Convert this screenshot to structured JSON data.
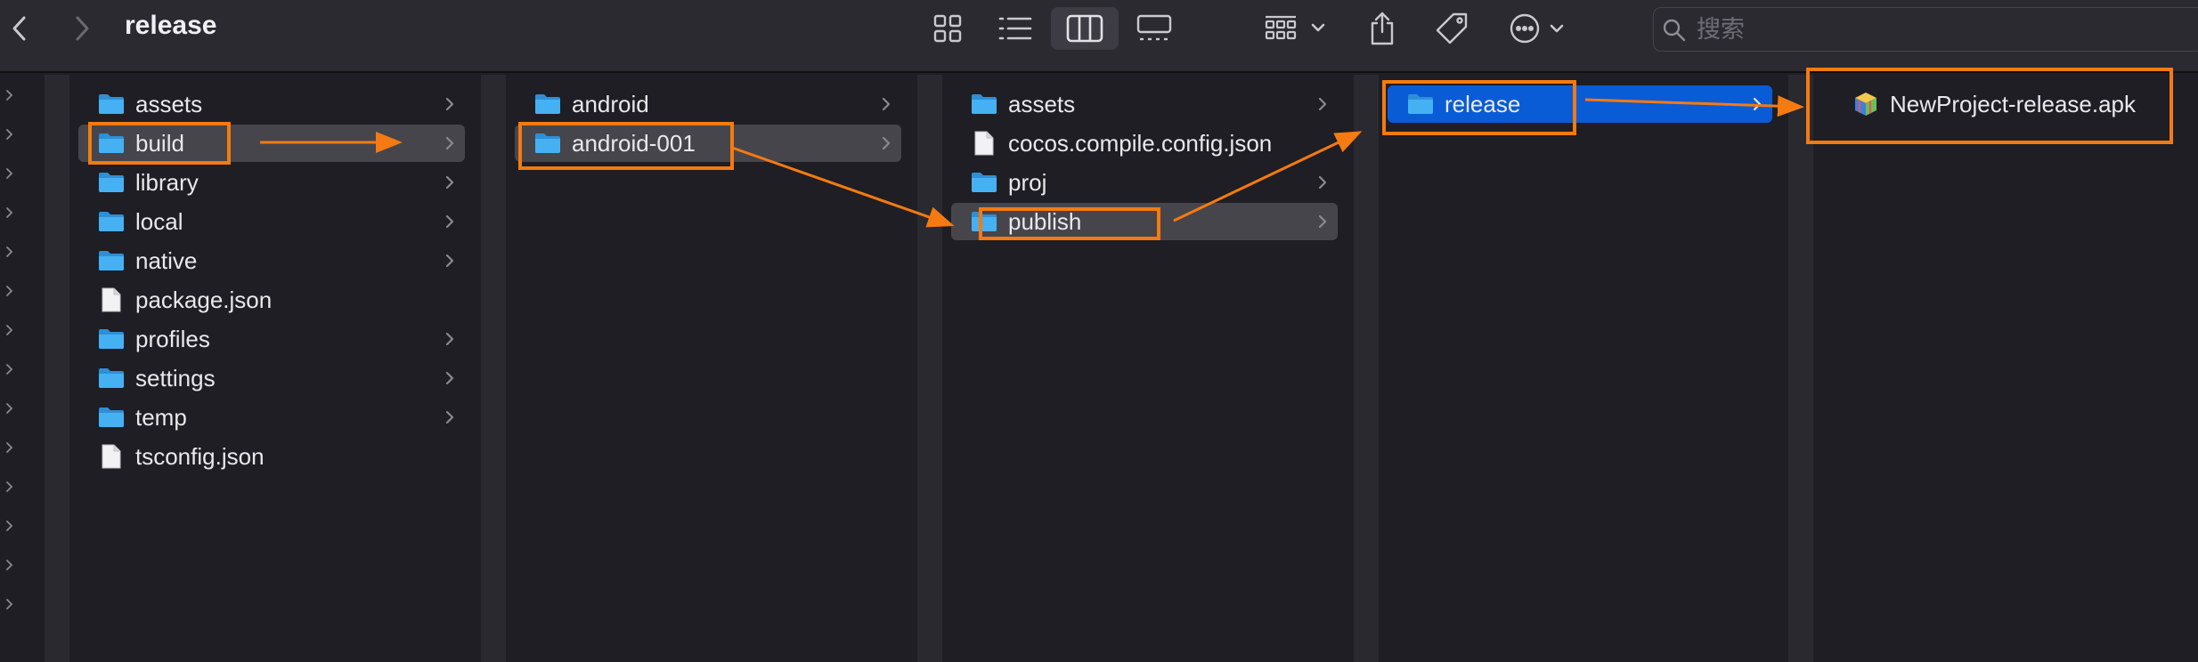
{
  "window": {
    "title": "release"
  },
  "toolbar": {
    "back_icon": "chevron-left-icon",
    "forward_icon": "chevron-right-icon",
    "view_icons": [
      "grid-view-icon",
      "list-view-icon",
      "column-view-icon",
      "gallery-view-icon"
    ],
    "active_view": "column-view-icon",
    "group_icon": "group-icon",
    "share_icon": "share-icon",
    "tag_icon": "tag-icon",
    "more_icon": "more-icon"
  },
  "search": {
    "placeholder": "搜索",
    "icon": "search-icon"
  },
  "colors": {
    "background": "#1e1e24",
    "toolbar": "#2b2a31",
    "folder": "#3aa7ee",
    "selection_blue": "#0a5bd6",
    "selection_gray": "#46454c",
    "annotation": "#f47a11"
  },
  "columns": [
    {
      "items": [
        {
          "label": "assets",
          "type": "folder"
        },
        {
          "label": "build",
          "type": "folder",
          "highlight": "gray"
        },
        {
          "label": "library",
          "type": "folder"
        },
        {
          "label": "local",
          "type": "folder"
        },
        {
          "label": "native",
          "type": "folder"
        },
        {
          "label": "package.json",
          "type": "file"
        },
        {
          "label": "profiles",
          "type": "folder"
        },
        {
          "label": "settings",
          "type": "folder"
        },
        {
          "label": "temp",
          "type": "folder"
        },
        {
          "label": "tsconfig.json",
          "type": "file"
        }
      ]
    },
    {
      "items": [
        {
          "label": "android",
          "type": "folder"
        },
        {
          "label": "android-001",
          "type": "folder",
          "highlight": "gray"
        }
      ]
    },
    {
      "items": [
        {
          "label": "assets",
          "type": "folder"
        },
        {
          "label": "cocos.compile.config.json",
          "type": "file"
        },
        {
          "label": "proj",
          "type": "folder"
        },
        {
          "label": "publish",
          "type": "folder",
          "highlight": "gray"
        }
      ]
    },
    {
      "items": [
        {
          "label": "release",
          "type": "folder",
          "highlight": "blue"
        }
      ]
    },
    {
      "items": [
        {
          "label": "NewProject-release.apk",
          "type": "apk"
        }
      ]
    }
  ]
}
